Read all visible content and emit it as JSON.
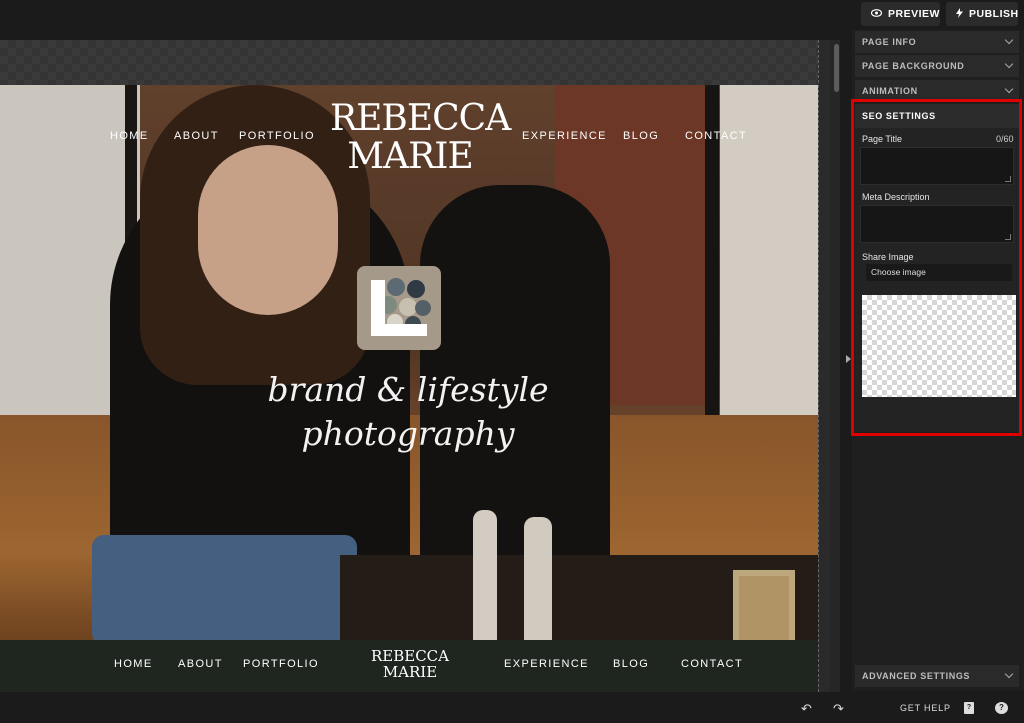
{
  "toolbar": {
    "preview_label": "PREVIEW",
    "preview_icon": "eye-icon",
    "publish_label": "PUBLISH",
    "publish_icon": "bolt-icon"
  },
  "site": {
    "brand": "REBECCA MARIE",
    "nav_left": [
      "HOME",
      "ABOUT",
      "PORTFOLIO"
    ],
    "nav_right": [
      "EXPERIENCE",
      "BLOG",
      "CONTACT"
    ],
    "tagline": "brand & lifestyle photography",
    "footer_left": [
      "HOME",
      "ABOUT",
      "PORTFOLIO"
    ],
    "footer_right": [
      "EXPERIENCE",
      "BLOG",
      "CONTACT"
    ],
    "footer_brand": "REBECCA MARIE"
  },
  "panel": {
    "sections_top": [
      "PAGE INFO",
      "PAGE BACKGROUND",
      "ANIMATION"
    ],
    "seo": {
      "header": "SEO SETTINGS",
      "page_title_label": "Page Title",
      "page_title_count": "0/60",
      "page_title_value": "",
      "meta_description_label": "Meta Description",
      "meta_description_value": "",
      "share_image_label": "Share Image",
      "choose_image_label": "Choose image"
    },
    "advanced": "ADVANCED SETTINGS",
    "highlight_color": "#e00000"
  },
  "bottombar": {
    "undo_icon": "undo-icon",
    "redo_icon": "redo-icon",
    "get_help_label": "GET HELP",
    "docs_icon": "docs-icon",
    "chat_icon": "chat-icon"
  }
}
